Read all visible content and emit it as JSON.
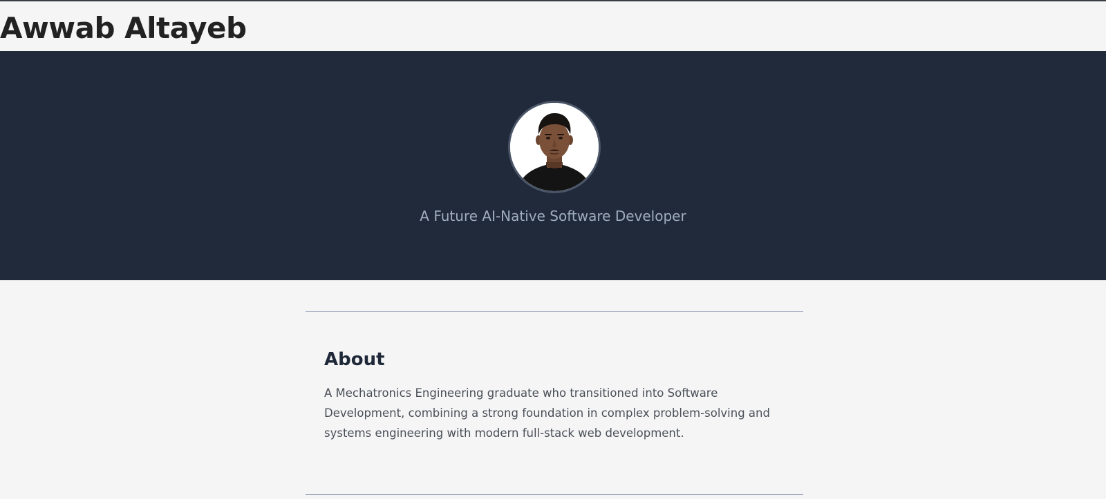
{
  "header": {
    "title": "Awwab Altayeb"
  },
  "hero": {
    "avatar_icon": "profile-photo",
    "tagline": "A Future AI-Native Software Developer"
  },
  "about": {
    "title": "About",
    "body": "A Mechatronics Engineering graduate who transitioned into Software Development, combining a strong foundation in complex problem-solving and systems engineering with modern full-stack web development."
  },
  "colors": {
    "hero_background": "#212a3a",
    "page_background": "#f5f5f5",
    "tagline": "#a0aec0",
    "heading": "#1e2838"
  }
}
